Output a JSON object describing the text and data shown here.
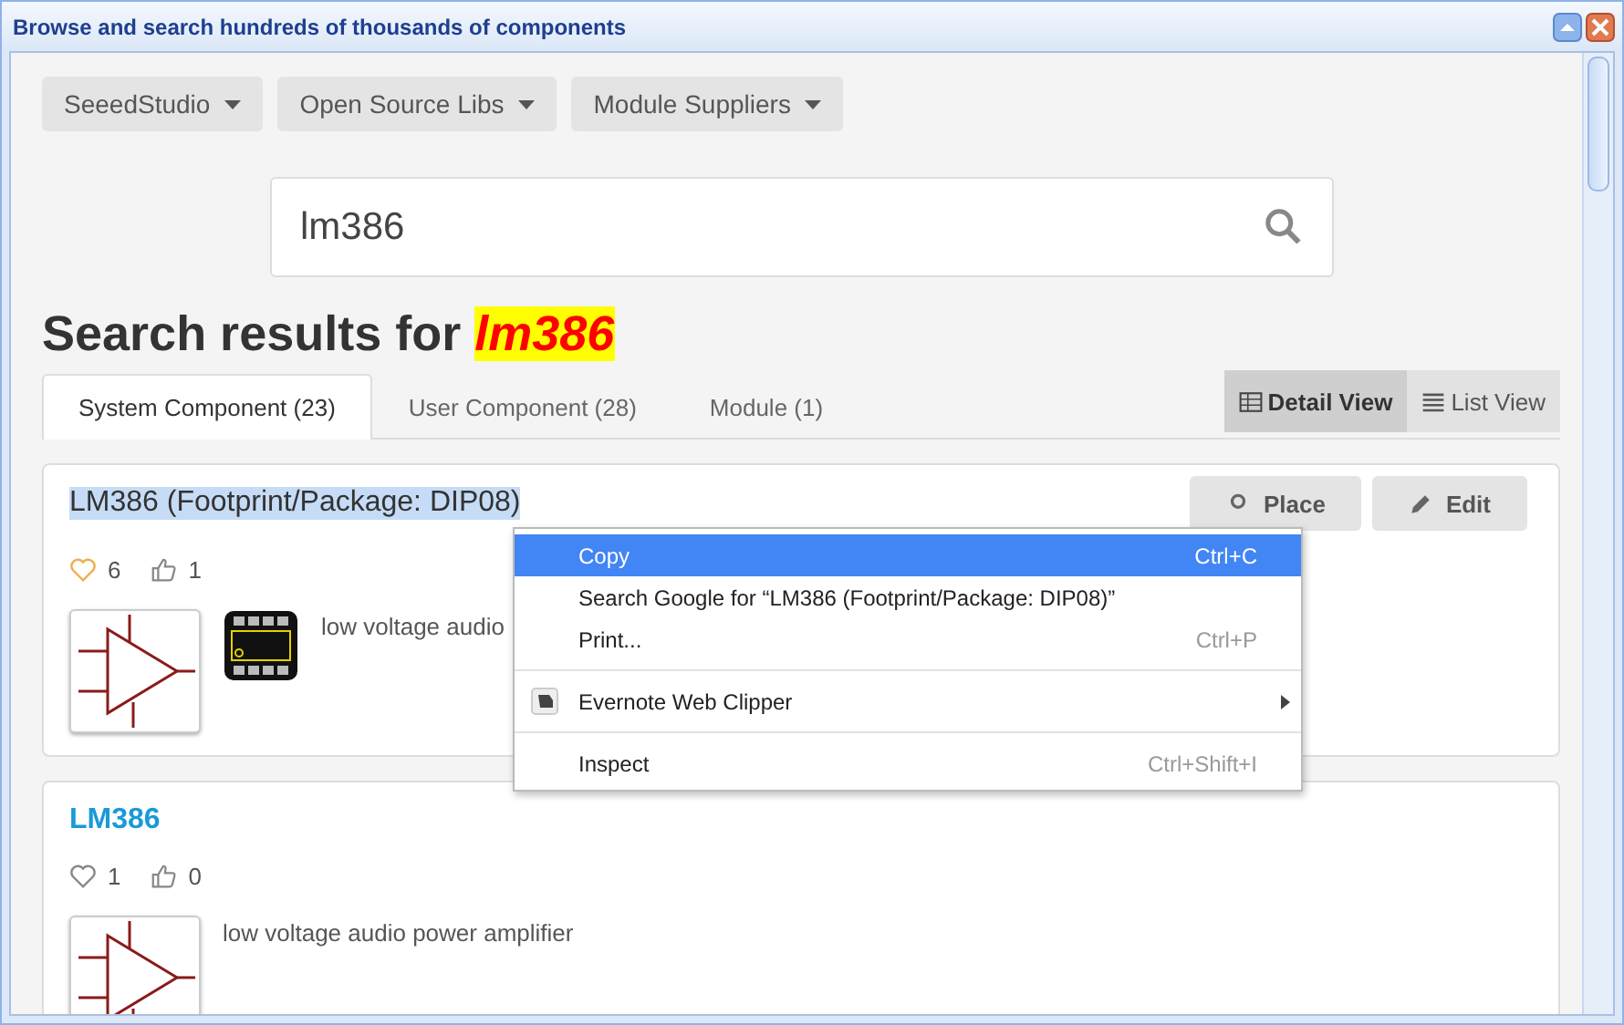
{
  "window": {
    "title": "Browse and search hundreds of thousands of components"
  },
  "filters": [
    {
      "label": "SeeedStudio"
    },
    {
      "label": "Open Source Libs"
    },
    {
      "label": "Module Suppliers"
    }
  ],
  "search": {
    "value": "lm386"
  },
  "heading": {
    "prefix": "Search results for",
    "query": "lm386"
  },
  "tabs": [
    {
      "label": "System Component (23)",
      "selected": true
    },
    {
      "label": "User Component (28)",
      "selected": false
    },
    {
      "label": "Module (1)",
      "selected": false
    }
  ],
  "views": [
    {
      "label": "Detail View",
      "kind": "detail",
      "selected": true
    },
    {
      "label": "List View",
      "kind": "list",
      "selected": false
    }
  ],
  "results": [
    {
      "title": "LM386 (Footprint/Package: DIP08)",
      "text_selected": true,
      "favorited": true,
      "favorites": "6",
      "likes": "1",
      "thumbnails": [
        {
          "kind": "schematic"
        },
        {
          "kind": "package"
        }
      ],
      "description": "low voltage audio",
      "actions": [
        {
          "label": "Place",
          "kind": "place"
        },
        {
          "label": "Edit",
          "kind": "edit"
        }
      ]
    },
    {
      "title": "LM386",
      "text_selected": false,
      "favorited": false,
      "favorites": "1",
      "likes": "0",
      "thumbnails": [
        {
          "kind": "schematic"
        }
      ],
      "description": "low voltage audio power amplifier"
    }
  ],
  "context_menu": [
    {
      "kind": "item",
      "label": "Copy",
      "shortcut": "Ctrl+C",
      "selected": true
    },
    {
      "kind": "item",
      "label": "Search Google for “LM386 (Footprint/Package: DIP08)”",
      "selected": false
    },
    {
      "kind": "item",
      "label": "Print...",
      "shortcut": "Ctrl+P",
      "selected": false
    },
    {
      "kind": "separator"
    },
    {
      "kind": "extension",
      "label": "Evernote Web Clipper",
      "submenu": true,
      "selected": false
    },
    {
      "kind": "separator"
    },
    {
      "kind": "item",
      "label": "Inspect",
      "shortcut": "Ctrl+Shift+I",
      "selected": false
    }
  ]
}
